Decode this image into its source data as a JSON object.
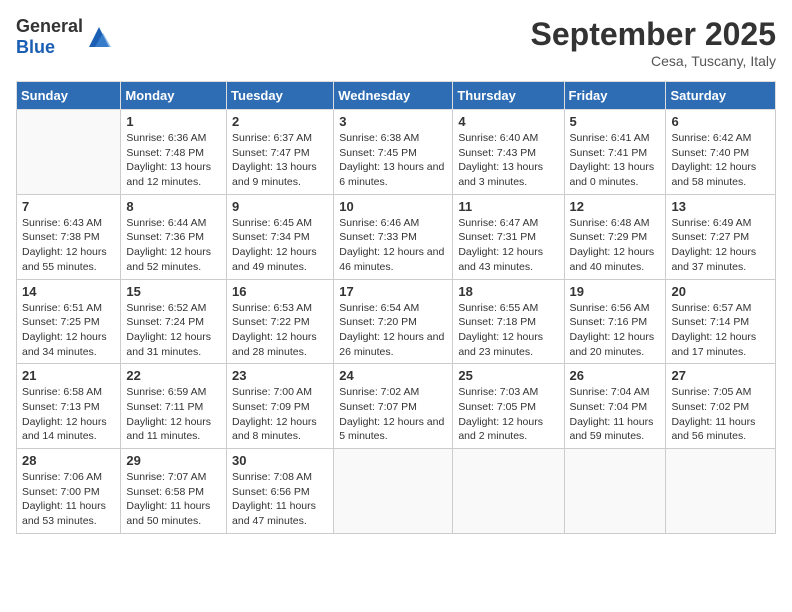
{
  "header": {
    "logo_general": "General",
    "logo_blue": "Blue",
    "month_title": "September 2025",
    "subtitle": "Cesa, Tuscany, Italy"
  },
  "weekdays": [
    "Sunday",
    "Monday",
    "Tuesday",
    "Wednesday",
    "Thursday",
    "Friday",
    "Saturday"
  ],
  "weeks": [
    [
      {
        "day": "",
        "sunrise": "",
        "sunset": "",
        "daylight": ""
      },
      {
        "day": "1",
        "sunrise": "Sunrise: 6:36 AM",
        "sunset": "Sunset: 7:48 PM",
        "daylight": "Daylight: 13 hours and 12 minutes."
      },
      {
        "day": "2",
        "sunrise": "Sunrise: 6:37 AM",
        "sunset": "Sunset: 7:47 PM",
        "daylight": "Daylight: 13 hours and 9 minutes."
      },
      {
        "day": "3",
        "sunrise": "Sunrise: 6:38 AM",
        "sunset": "Sunset: 7:45 PM",
        "daylight": "Daylight: 13 hours and 6 minutes."
      },
      {
        "day": "4",
        "sunrise": "Sunrise: 6:40 AM",
        "sunset": "Sunset: 7:43 PM",
        "daylight": "Daylight: 13 hours and 3 minutes."
      },
      {
        "day": "5",
        "sunrise": "Sunrise: 6:41 AM",
        "sunset": "Sunset: 7:41 PM",
        "daylight": "Daylight: 13 hours and 0 minutes."
      },
      {
        "day": "6",
        "sunrise": "Sunrise: 6:42 AM",
        "sunset": "Sunset: 7:40 PM",
        "daylight": "Daylight: 12 hours and 58 minutes."
      }
    ],
    [
      {
        "day": "7",
        "sunrise": "Sunrise: 6:43 AM",
        "sunset": "Sunset: 7:38 PM",
        "daylight": "Daylight: 12 hours and 55 minutes."
      },
      {
        "day": "8",
        "sunrise": "Sunrise: 6:44 AM",
        "sunset": "Sunset: 7:36 PM",
        "daylight": "Daylight: 12 hours and 52 minutes."
      },
      {
        "day": "9",
        "sunrise": "Sunrise: 6:45 AM",
        "sunset": "Sunset: 7:34 PM",
        "daylight": "Daylight: 12 hours and 49 minutes."
      },
      {
        "day": "10",
        "sunrise": "Sunrise: 6:46 AM",
        "sunset": "Sunset: 7:33 PM",
        "daylight": "Daylight: 12 hours and 46 minutes."
      },
      {
        "day": "11",
        "sunrise": "Sunrise: 6:47 AM",
        "sunset": "Sunset: 7:31 PM",
        "daylight": "Daylight: 12 hours and 43 minutes."
      },
      {
        "day": "12",
        "sunrise": "Sunrise: 6:48 AM",
        "sunset": "Sunset: 7:29 PM",
        "daylight": "Daylight: 12 hours and 40 minutes."
      },
      {
        "day": "13",
        "sunrise": "Sunrise: 6:49 AM",
        "sunset": "Sunset: 7:27 PM",
        "daylight": "Daylight: 12 hours and 37 minutes."
      }
    ],
    [
      {
        "day": "14",
        "sunrise": "Sunrise: 6:51 AM",
        "sunset": "Sunset: 7:25 PM",
        "daylight": "Daylight: 12 hours and 34 minutes."
      },
      {
        "day": "15",
        "sunrise": "Sunrise: 6:52 AM",
        "sunset": "Sunset: 7:24 PM",
        "daylight": "Daylight: 12 hours and 31 minutes."
      },
      {
        "day": "16",
        "sunrise": "Sunrise: 6:53 AM",
        "sunset": "Sunset: 7:22 PM",
        "daylight": "Daylight: 12 hours and 28 minutes."
      },
      {
        "day": "17",
        "sunrise": "Sunrise: 6:54 AM",
        "sunset": "Sunset: 7:20 PM",
        "daylight": "Daylight: 12 hours and 26 minutes."
      },
      {
        "day": "18",
        "sunrise": "Sunrise: 6:55 AM",
        "sunset": "Sunset: 7:18 PM",
        "daylight": "Daylight: 12 hours and 23 minutes."
      },
      {
        "day": "19",
        "sunrise": "Sunrise: 6:56 AM",
        "sunset": "Sunset: 7:16 PM",
        "daylight": "Daylight: 12 hours and 20 minutes."
      },
      {
        "day": "20",
        "sunrise": "Sunrise: 6:57 AM",
        "sunset": "Sunset: 7:14 PM",
        "daylight": "Daylight: 12 hours and 17 minutes."
      }
    ],
    [
      {
        "day": "21",
        "sunrise": "Sunrise: 6:58 AM",
        "sunset": "Sunset: 7:13 PM",
        "daylight": "Daylight: 12 hours and 14 minutes."
      },
      {
        "day": "22",
        "sunrise": "Sunrise: 6:59 AM",
        "sunset": "Sunset: 7:11 PM",
        "daylight": "Daylight: 12 hours and 11 minutes."
      },
      {
        "day": "23",
        "sunrise": "Sunrise: 7:00 AM",
        "sunset": "Sunset: 7:09 PM",
        "daylight": "Daylight: 12 hours and 8 minutes."
      },
      {
        "day": "24",
        "sunrise": "Sunrise: 7:02 AM",
        "sunset": "Sunset: 7:07 PM",
        "daylight": "Daylight: 12 hours and 5 minutes."
      },
      {
        "day": "25",
        "sunrise": "Sunrise: 7:03 AM",
        "sunset": "Sunset: 7:05 PM",
        "daylight": "Daylight: 12 hours and 2 minutes."
      },
      {
        "day": "26",
        "sunrise": "Sunrise: 7:04 AM",
        "sunset": "Sunset: 7:04 PM",
        "daylight": "Daylight: 11 hours and 59 minutes."
      },
      {
        "day": "27",
        "sunrise": "Sunrise: 7:05 AM",
        "sunset": "Sunset: 7:02 PM",
        "daylight": "Daylight: 11 hours and 56 minutes."
      }
    ],
    [
      {
        "day": "28",
        "sunrise": "Sunrise: 7:06 AM",
        "sunset": "Sunset: 7:00 PM",
        "daylight": "Daylight: 11 hours and 53 minutes."
      },
      {
        "day": "29",
        "sunrise": "Sunrise: 7:07 AM",
        "sunset": "Sunset: 6:58 PM",
        "daylight": "Daylight: 11 hours and 50 minutes."
      },
      {
        "day": "30",
        "sunrise": "Sunrise: 7:08 AM",
        "sunset": "Sunset: 6:56 PM",
        "daylight": "Daylight: 11 hours and 47 minutes."
      },
      {
        "day": "",
        "sunrise": "",
        "sunset": "",
        "daylight": ""
      },
      {
        "day": "",
        "sunrise": "",
        "sunset": "",
        "daylight": ""
      },
      {
        "day": "",
        "sunrise": "",
        "sunset": "",
        "daylight": ""
      },
      {
        "day": "",
        "sunrise": "",
        "sunset": "",
        "daylight": ""
      }
    ]
  ]
}
